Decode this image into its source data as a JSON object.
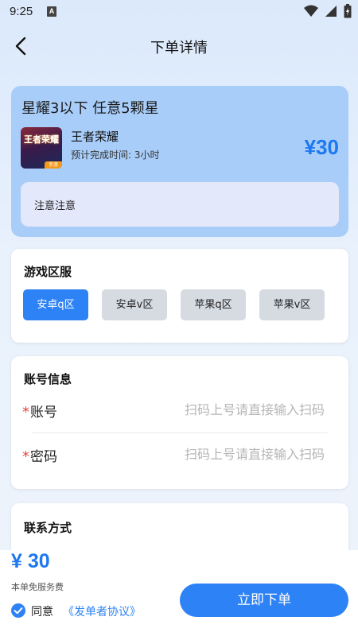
{
  "status_bar": {
    "time": "9:25",
    "notification_letter": "A",
    "icons": [
      "wifi-icon",
      "signal-icon",
      "battery-icon"
    ]
  },
  "nav": {
    "title": "下单详情",
    "back_icon": "chevron-left-icon"
  },
  "order": {
    "title": "星耀3以下 任意5颗星",
    "game_name": "王者荣耀",
    "thumb_text": "王者荣耀",
    "thumb_badge": "手游",
    "eta": "预计完成时间: 3小时",
    "price": "¥30",
    "note": "注意注意"
  },
  "region": {
    "title": "游戏区服",
    "options": [
      "安卓q区",
      "安卓v区",
      "苹果q区",
      "苹果v区"
    ],
    "selected": "安卓q区"
  },
  "account": {
    "title": "账号信息",
    "required_mark": "*",
    "account_label": "账号",
    "account_placeholder": "扫码上号请直接输入扫码",
    "password_label": "密码",
    "password_placeholder": "扫码上号请直接输入扫码"
  },
  "contact": {
    "title": "联系方式"
  },
  "footer": {
    "price": "¥ 30",
    "fee_note": "本单免服务费",
    "agree_label": "同意",
    "agreement_link": "《发单者协议》",
    "submit_label": "立即下单"
  },
  "colors": {
    "accent": "#2d82f5",
    "price": "#1e78ee",
    "order_card_bg": "#a8cdf9",
    "required": "#e54545"
  }
}
